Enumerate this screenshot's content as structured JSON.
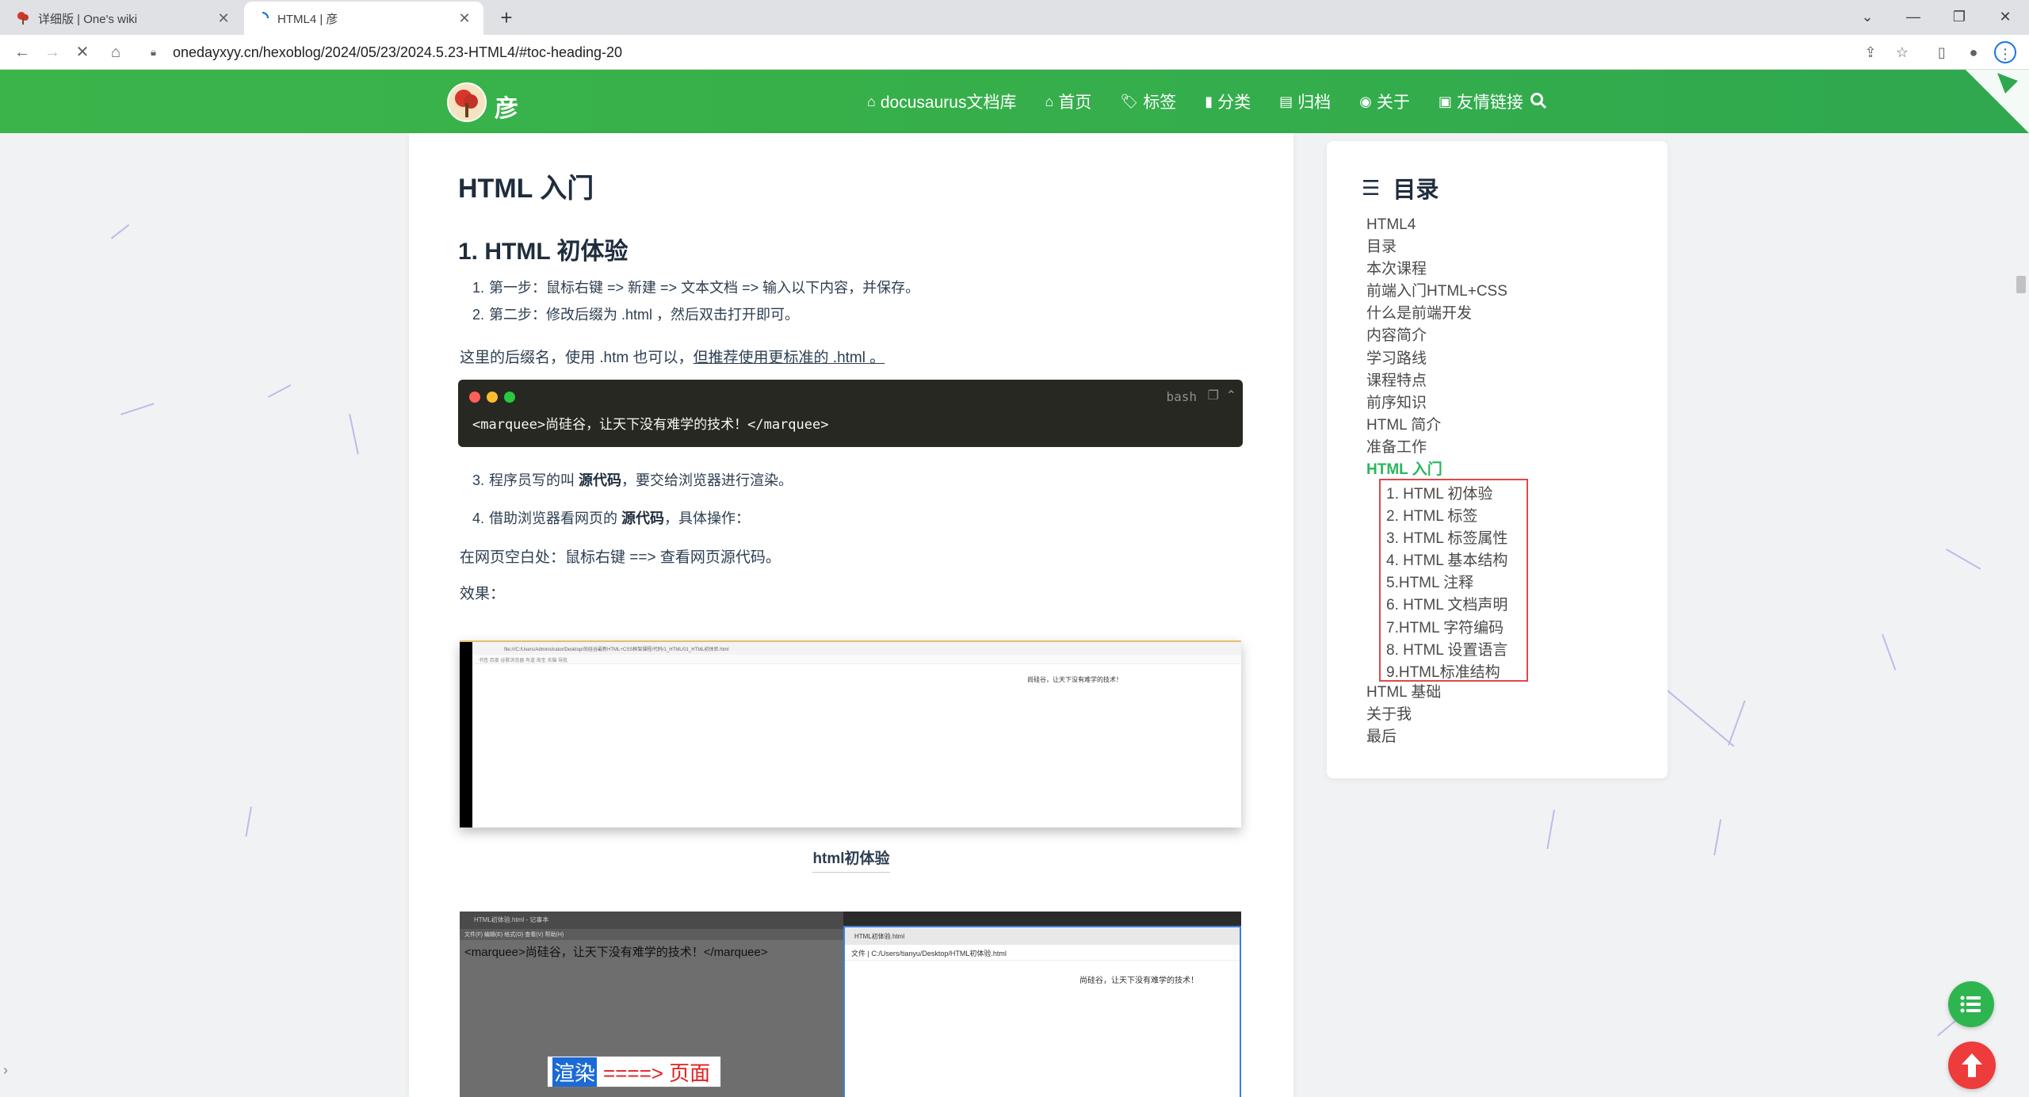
{
  "browser": {
    "tabs": [
      {
        "title": "详细版 | One's wiki",
        "active": false
      },
      {
        "title": "HTML4 | 彦",
        "active": true
      }
    ],
    "url": "onedayxyy.cn/hexoblog/2024/05/23/2024.5.23-HTML4/#toc-heading-20"
  },
  "site": {
    "logo_text": "彦",
    "menu": [
      {
        "icon": "home-icon",
        "label": "docusaurus文档库"
      },
      {
        "icon": "home-icon",
        "label": "首页"
      },
      {
        "icon": "tags-icon",
        "label": "标签"
      },
      {
        "icon": "bookmark-icon",
        "label": "分类"
      },
      {
        "icon": "archive-icon",
        "label": "归档"
      },
      {
        "icon": "user-circle-icon",
        "label": "关于"
      },
      {
        "icon": "contact-card-icon",
        "label": "友情链接"
      }
    ]
  },
  "article": {
    "h1": "HTML 入门",
    "h2": "1. HTML 初体验",
    "steps": [
      {
        "num": "1.",
        "text": "第一步：鼠标右键 => 新建 => 文本文档 => 输入以下内容，并保存。"
      },
      {
        "num": "2.",
        "text": "第二步：修改后缀为 .html ，然后双击打开即可。"
      }
    ],
    "suffix_note": "这里的后缀名，使用 .htm 也可以，",
    "suffix_link": "但推荐使用更标准的 .html 。",
    "code": {
      "lang": "bash",
      "line": "<marquee>尚硅谷，让天下没有难学的技术！</marquee>"
    },
    "step3_num": "3.",
    "step3_pre": "程序员写的叫 ",
    "step3_bold": "源代码",
    "step3_post": "，要交给浏览器进行渲染。",
    "step4_num": "4.",
    "step4_pre": "借助浏览器看网页的 ",
    "step4_bold": "源代码",
    "step4_post": "，具体操作：",
    "view_source": "在网页空白处：鼠标右键 ==> 查看网页源代码。",
    "effect": "效果：",
    "shot1": {
      "address": "file:///C:/Users/Administrator/Desktop/尚硅谷最新HTML+CSS框架课程/代码/1_HTML/01_HTML初体验.html",
      "bookmarks": "书签   百度   谷歌浏览器   有道   淘宝   天猫   导航",
      "text": "尚硅谷，让天下没有难学的技术！"
    },
    "caption1": "html初体验",
    "shot2": {
      "np_title": "HTML初体验.html - 记事本",
      "np_menu": "文件(F)  编辑(E)  格式(O)  查看(V)  帮助(H)",
      "np_text": "<marquee>尚硅谷，让天下没有难学的技术！</marquee>",
      "b_tab": "HTML初体验.html",
      "b_addr": "文件 | C:/Users/tianyu/Desktop/HTML初体验.html",
      "b_text": "尚硅谷，让天下没有难学的技术！",
      "render_word": "渲染",
      "render_arrow": "====> 页面"
    }
  },
  "toc": {
    "title": "目录",
    "items": [
      "HTML4",
      "目录",
      "本次课程",
      "前端入门HTML+CSS",
      "什么是前端开发",
      "内容简介",
      "学习路线",
      "课程特点",
      "前序知识",
      "HTML 简介",
      "准备工作"
    ],
    "active": "HTML 入门",
    "sub": [
      "1. HTML 初体验",
      "2. HTML 标签",
      "3. HTML 标签属性",
      "4. HTML 基本结构",
      "5.HTML 注释",
      "6. HTML 文档声明",
      "7.HTML 字符编码",
      "8. HTML 设置语言",
      "9.HTML标准结构"
    ],
    "after": [
      "HTML 基础",
      "关于我",
      "最后"
    ]
  },
  "colors": {
    "header_green": "#3bb54a",
    "toc_active": "#28b75c",
    "toc_highlight_border": "#e04848",
    "fab_toc": "#2fb54f",
    "fab_top": "#ee3b3b"
  }
}
